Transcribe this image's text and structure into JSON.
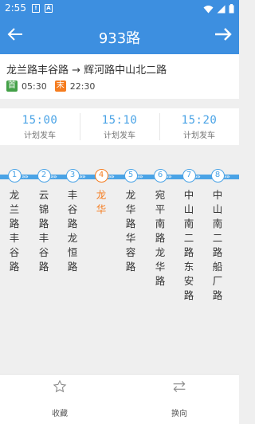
{
  "status_bar": {
    "time": "2:55",
    "icons": [
      "notification-box-icon",
      "text-box-icon",
      "wifi-icon",
      "signal-icon",
      "battery-icon"
    ]
  },
  "header": {
    "title": "933路",
    "back_icon": "back-arrow-icon",
    "reverse_icon": "forward-arrow-icon"
  },
  "route": {
    "direction": "龙兰路丰谷路 → 辉河路中山北二路",
    "first_tag": "首",
    "first_time": "05:30",
    "last_tag": "末",
    "last_time": "22:30"
  },
  "schedule": [
    {
      "time": "15:00",
      "label": "计划发车"
    },
    {
      "time": "15:10",
      "label": "计划发车"
    },
    {
      "time": "15:20",
      "label": "计划发车"
    }
  ],
  "stops": [
    {
      "num": "1",
      "name": "龙兰路丰谷路"
    },
    {
      "num": "2",
      "name": "云锦路丰谷路"
    },
    {
      "num": "3",
      "name": "丰谷路龙恒路"
    },
    {
      "num": "4",
      "name": "龙华"
    },
    {
      "num": "5",
      "name": "龙华路华容路"
    },
    {
      "num": "6",
      "name": "宛平南路龙华路"
    },
    {
      "num": "7",
      "name": "中山南二路东安路"
    },
    {
      "num": "8",
      "name": "中山南二路船厂路"
    }
  ],
  "current_stop": 4,
  "bottom_bar": {
    "favorite_label": "收藏",
    "favorite_icon": "star-icon",
    "reverse_label": "换向",
    "reverse_icon": "swap-icon"
  },
  "colors": {
    "primary": "#3d8fe0",
    "line": "#4aa3e6",
    "highlight": "#f57c1f",
    "first_tag": "#43a047"
  }
}
